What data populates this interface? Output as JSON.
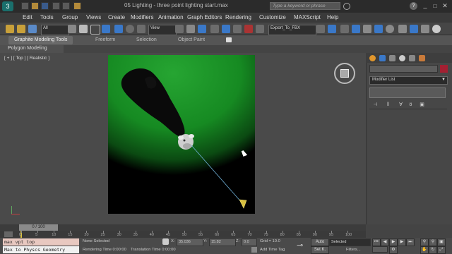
{
  "window": {
    "title": "05 Lighting - three point lighting start.max",
    "search_placeholder": "Type a keyword or phrase"
  },
  "menu": [
    "Edit",
    "Tools",
    "Group",
    "Views",
    "Create",
    "Modifiers",
    "Animation",
    "Graph Editors",
    "Rendering",
    "Customize",
    "MAXScript",
    "Help"
  ],
  "toolbar": {
    "selection_filter": "All",
    "ref_coord": "View",
    "named_selection": "Export_To_FBX"
  },
  "ribbon": {
    "tabs": [
      "Graphite Modeling Tools",
      "Freeform",
      "Selection",
      "Object Paint"
    ],
    "sub_label": "Polygon Modeling"
  },
  "viewport": {
    "label": "[ + ] [ Top ] [ Realistic ]"
  },
  "command_panel": {
    "modifier_list": "Modifier List"
  },
  "timeline": {
    "frame_display": "0 / 100",
    "ticks": [
      "0",
      "5",
      "10",
      "15",
      "20",
      "25",
      "30",
      "35",
      "40",
      "45",
      "50",
      "55",
      "60",
      "65",
      "70",
      "75",
      "80",
      "85",
      "90",
      "95",
      "100"
    ]
  },
  "listener": {
    "line1": "max vpt top",
    "line2": "Max to Physcs Geometry"
  },
  "status": {
    "selection": "None Selected",
    "prompt": "Rendering Time  0:00:00",
    "translation": "Translation Time  0:00:00",
    "x_label": "X:",
    "x_value": "35.036",
    "y_label": "Y:",
    "y_value": "15.82",
    "z_label": "Z:",
    "z_value": "0.0",
    "grid": "Grid = 10.0",
    "add_time_tag": "Add Time Tag",
    "auto_key": "Auto",
    "set_key": "Set K.",
    "key_mode": "Selected",
    "filters": "Filters..."
  },
  "colors": {
    "accent_blue": "#3a78c8",
    "highlight_red": "#a32032",
    "listener_bg": "#e8c8c0",
    "render_green": "#1fa02a"
  }
}
